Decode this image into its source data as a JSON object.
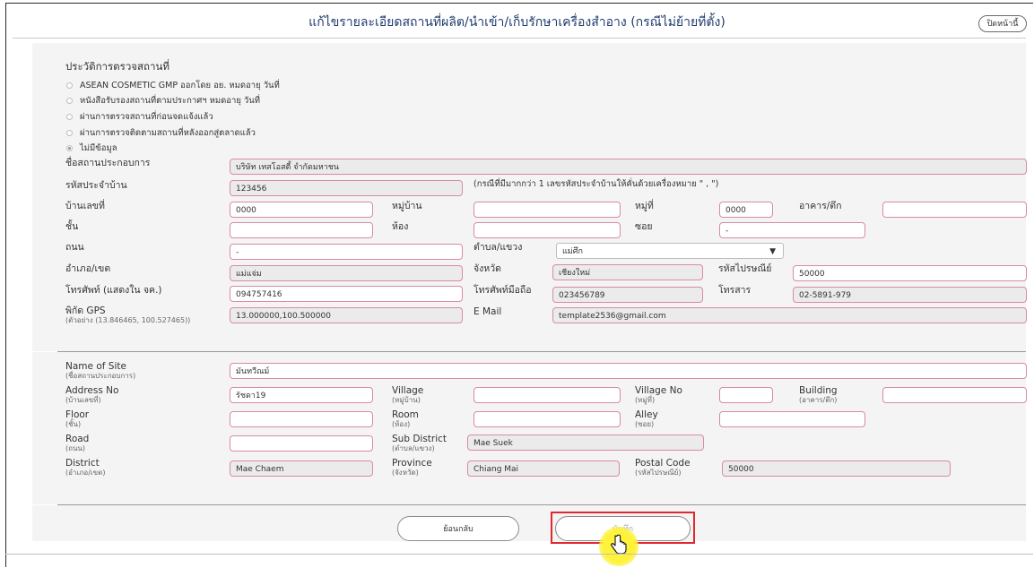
{
  "header": {
    "title": "แก้ไขรายละเอียดสถานที่ผลิต/นำเข้า/เก็บรักษาเครื่องสำอาง (กรณีไม่ย้ายที่ตั้ง)",
    "close_label": "ปิดหน้านี้"
  },
  "history": {
    "title": "ประวัติการตรวจสถานที่",
    "options": [
      {
        "label": "ASEAN COSMETIC GMP ออกโดย อย.  หมดอายุ วันที่",
        "selected": false
      },
      {
        "label": "หนังสือรับรองสถานที่ตามประกาศฯ  หมดอายุ วันที่",
        "selected": false
      },
      {
        "label": "ผ่านการตรวจสถานที่ก่อนจดแจ้งแล้ว",
        "selected": false
      },
      {
        "label": "ผ่านการตรวจติดตามสถานที่หลังออกสู่ตลาดแล้ว",
        "selected": false
      },
      {
        "label": "ไม่มีข้อมูล",
        "selected": true
      }
    ]
  },
  "thai": {
    "site_name": {
      "label": "ชื่อสถานประกอบการ",
      "value": "บริษัท เทสโอสตี้ จำกัดมหาชน"
    },
    "house_id": {
      "label": "รหัสประจำบ้าน",
      "value": "123456",
      "note": "(กรณีที่มีมากกว่า 1 เลขรหัสประจำบ้านให้คั่นด้วยเครื่องหมาย \" , \")"
    },
    "house_no": {
      "label": "บ้านเลขที่",
      "value": "0000"
    },
    "village": {
      "label": "หมู่บ้าน",
      "value": ""
    },
    "moo": {
      "label": "หมู่ที่",
      "value": "0000"
    },
    "building": {
      "label": "อาคาร/ตึก",
      "value": ""
    },
    "floor": {
      "label": "ชั้น",
      "value": ""
    },
    "room": {
      "label": "ห้อง",
      "value": ""
    },
    "alley": {
      "label": "ซอย",
      "value": "-"
    },
    "road": {
      "label": "ถนน",
      "value": "-"
    },
    "subdistrict": {
      "label": "ตำบล/แขวง",
      "value": "แม่ศึก"
    },
    "district": {
      "label": "อำเภอ/เขต",
      "value": "แม่แจ่ม"
    },
    "province": {
      "label": "จังหวัด",
      "value": "เชียงใหม่"
    },
    "postal": {
      "label": "รหัสไปรษณีย์",
      "value": "50000"
    },
    "phone": {
      "label": "โทรศัพท์ (แสดงใน จค.)",
      "value": "094757416"
    },
    "mobile": {
      "label": "โทรศัพท์มือถือ",
      "value": "023456789"
    },
    "fax": {
      "label": "โทรสาร",
      "value": "02-5891-979"
    },
    "gps": {
      "label": "พิกัด GPS",
      "sub": "(ตัวอย่าง (13.846465, 100.527465))",
      "value": "13.000000,100.500000"
    },
    "email": {
      "label": "E Mail",
      "value": "template2536@gmail.com"
    }
  },
  "eng": {
    "site_name": {
      "label": "Name of Site",
      "sub": "(ชื่อสถานประกอบการ)",
      "value": "มันทวีณม์"
    },
    "address_no": {
      "label": "Address No",
      "sub": "(บ้านเลขที่)",
      "value": "รัชดา19"
    },
    "village": {
      "label": "Village",
      "sub": "(หมู่บ้าน)",
      "value": ""
    },
    "village_no": {
      "label": "Village No",
      "sub": "(หมู่ที่)",
      "value": ""
    },
    "building": {
      "label": "Building",
      "sub": "(อาคาร/ตึก)",
      "value": ""
    },
    "floor": {
      "label": "Floor",
      "sub": "(ชั้น)",
      "value": ""
    },
    "room": {
      "label": "Room",
      "sub": "(ห้อง)",
      "value": ""
    },
    "alley": {
      "label": "Alley",
      "sub": "(ซอย)",
      "value": ""
    },
    "road": {
      "label": "Road",
      "sub": "(ถนน)",
      "value": ""
    },
    "subdistrict": {
      "label": "Sub District",
      "sub": "(ตำบล/แขวง)",
      "value": "Mae Suek"
    },
    "district": {
      "label": "District",
      "sub": "(อำเภอ/เขต)",
      "value": "Mae Chaem"
    },
    "province": {
      "label": "Province",
      "sub": "(จังหวัด)",
      "value": "Chiang Mai"
    },
    "postal": {
      "label": "Postal Code",
      "sub": "(รหัสไปรษณีย์)",
      "value": "50000"
    }
  },
  "actions": {
    "back_label": "ย้อนกลับ",
    "save_label": "บันทึก"
  }
}
